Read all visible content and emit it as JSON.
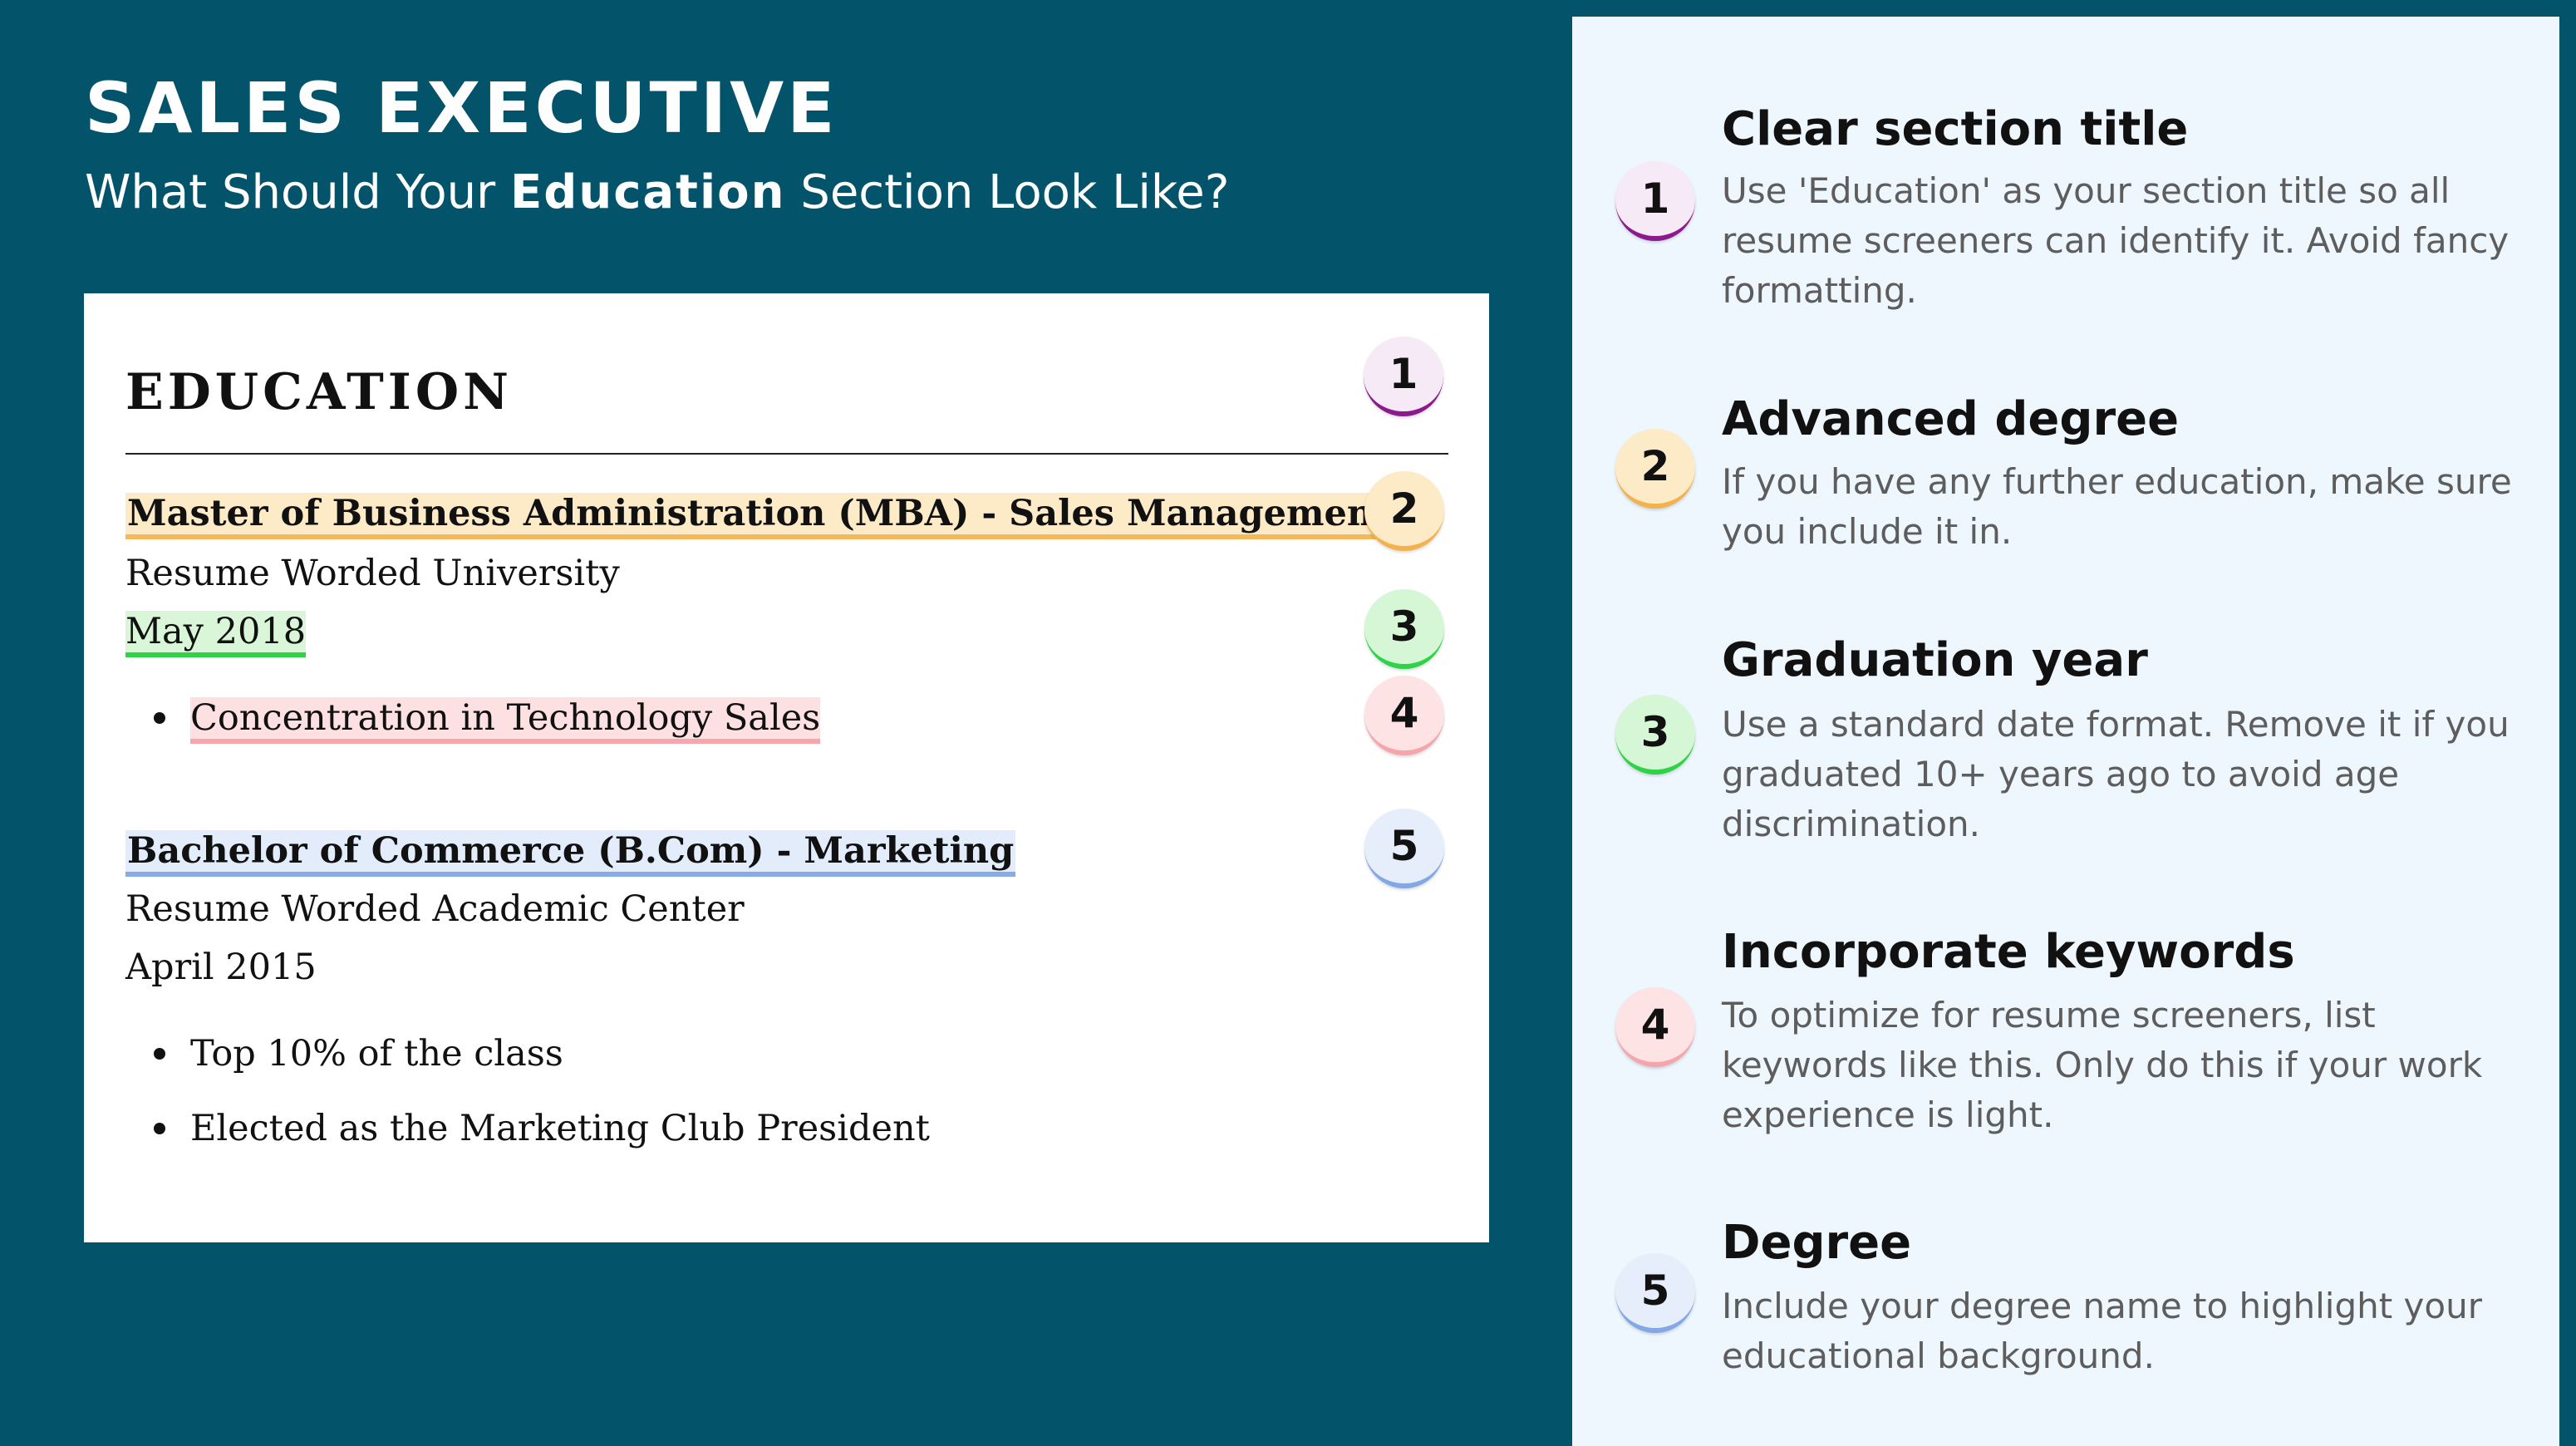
{
  "header": {
    "title": "SALES EXECUTIVE",
    "subtitle_prefix": "What Should Your ",
    "subtitle_bold": "Education",
    "subtitle_suffix": " Section Look Like?"
  },
  "resume": {
    "section_title": "EDUCATION",
    "entries": [
      {
        "degree": "Master of Business Administration (MBA) - Sales Management",
        "school": "Resume Worded University",
        "date": "May 2018",
        "bullets": [
          "Concentration in Technology Sales"
        ]
      },
      {
        "degree": "Bachelor of Commerce (B.Com) - Marketing",
        "school": "Resume Worded Academic Center",
        "date": "April 2015",
        "bullets": [
          "Top 10% of the class",
          "Elected as the Marketing Club President"
        ]
      }
    ]
  },
  "badges": [
    "1",
    "2",
    "3",
    "4",
    "5"
  ],
  "tips": [
    {
      "number": "1",
      "title": "Clear section title",
      "body": "Use 'Education' as your section title so all resume screeners can identify it. Avoid fancy formatting."
    },
    {
      "number": "2",
      "title": "Advanced degree",
      "body": "If you have any further education, make sure you include it in."
    },
    {
      "number": "3",
      "title": "Graduation year",
      "body": "Use a standard date format. Remove it if you graduated 10+ years ago to avoid age discrimination."
    },
    {
      "number": "4",
      "title": "Incorporate keywords",
      "body": "To optimize for resume screeners, list keywords like this. Only do this if your work experience is light."
    },
    {
      "number": "5",
      "title": "Degree",
      "body": "Include your degree name to highlight your educational background."
    }
  ],
  "colors": {
    "background": "#03536b",
    "panel": "#eef6fe",
    "badge_1": "#8c1a8e",
    "badge_2": "#f4b24f",
    "badge_3": "#2fd34a",
    "badge_4": "#f5a6ab",
    "badge_5": "#82a8e6"
  }
}
